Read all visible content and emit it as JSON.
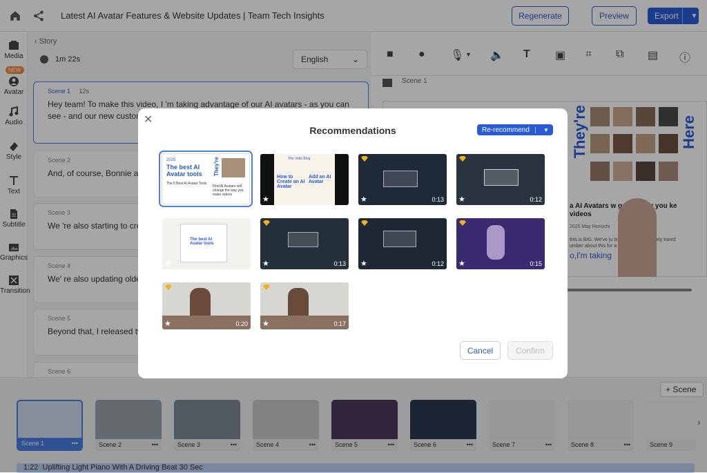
{
  "header": {
    "title": "Latest AI Avatar Features & Website Updates | Team Tech Insights",
    "regenerate": "Regenerate",
    "preview": "Preview",
    "export": "Export"
  },
  "sidebar": {
    "new_badge": "NEW",
    "items": [
      "Media",
      "Avatar",
      "Audio",
      "Style",
      "Text",
      "Subtitle",
      "Graphics",
      "Transition"
    ]
  },
  "story": {
    "back_label": "Story",
    "duration": "1m 22s",
    "language": "English",
    "scenes": [
      {
        "label": "Scene 1",
        "time": "12s",
        "text": "Hey team! To make this video, I 'm taking advantage of our AI avatars - as you can see - and our new custom vo features."
      },
      {
        "label": "Scene 2",
        "text": "And, of course, Bonnie ar these new custom voice c"
      },
      {
        "label": "Scene 3",
        "text": "We 're also starting to cre subtitle style library and c"
      },
      {
        "label": "Scene 4",
        "text": "We' re also updating olde optimized for the latest G"
      },
      {
        "label": "Scene 5",
        "text": "Beyond that, I released tw how to use our AI Avatar"
      },
      {
        "label": "Scene 6",
        "text": ""
      }
    ]
  },
  "editor": {
    "scene_label": "Scene 1",
    "canvas_theyre": "They're",
    "canvas_here": "Here",
    "canvas_heading": "a AI Avatars w ge the way you ke videos",
    "canvas_date": "2025 May Horiuchi",
    "canvas_body": "this is BIG. We've ju ting that will absolutely transf umber about this for a secon",
    "canvas_caption": "o,I'm taking"
  },
  "timeline": {
    "add_scene": "Scene",
    "thumbs": [
      "Scene 1",
      "Scene 2",
      "Scene 3",
      "Scene 4",
      "Scene 5",
      "Scene 6",
      "Scene 7",
      "Scene 8",
      "Scene 9"
    ],
    "music_time": "1:22",
    "music_title": "Uplifting Light Piano With A Driving Beat 30 Sec"
  },
  "modal": {
    "title": "Recommendations",
    "rerecommend": "Re-recommend",
    "cancel": "Cancel",
    "confirm": "Confirm",
    "card1_year": "2025",
    "card1_title": "The best AI Avatar tools",
    "card1_theyre": "They're",
    "card1_here": "Here",
    "card1_sub": "Find AI Avatars will change the way you make videos",
    "card1_small": "The 5 Best AI Avatar Tools",
    "card2_logo": "The Vidio Blog",
    "card2_left": "How to Create an AI Avatar",
    "card2_right": "Add an AI Avatar",
    "card5_title": "The best AI Avatar tools",
    "durations": [
      "",
      "",
      "0:13",
      "0:12",
      "",
      "0:13",
      "0:12",
      "0:15",
      "0:20",
      "0:17"
    ]
  }
}
